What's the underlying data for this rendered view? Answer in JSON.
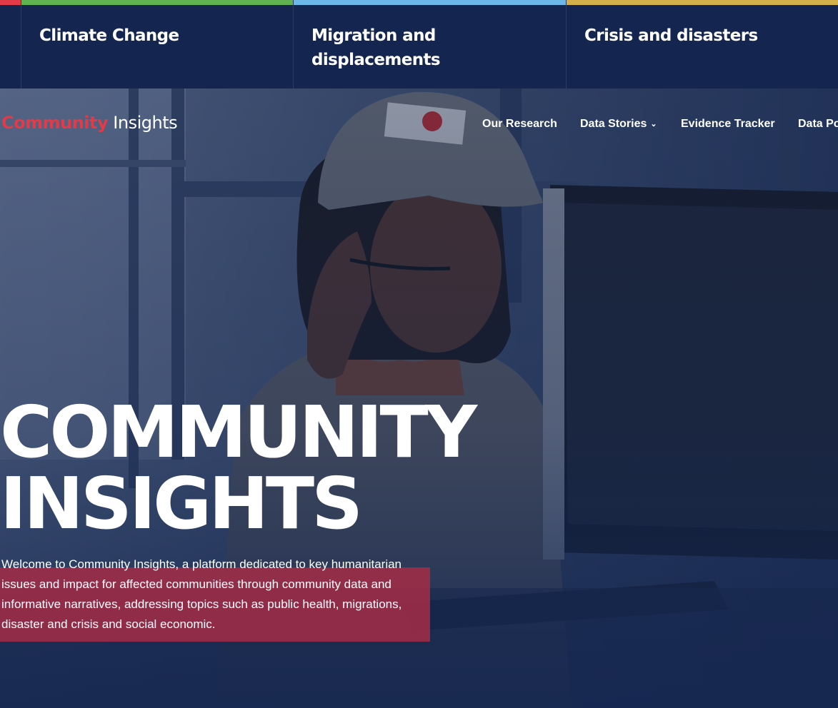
{
  "topics": [
    {
      "label": "",
      "color": "#e23a46"
    },
    {
      "label": "Climate Change",
      "color": "#5fb24f"
    },
    {
      "label": "Migration and displacements",
      "color": "#6cb8e8"
    },
    {
      "label": "Crisis and disasters",
      "color": "#d4b04a"
    }
  ],
  "brand": {
    "part1": "Community",
    "part2": "Insights"
  },
  "nav": {
    "items": [
      "Our Research",
      "Data Stories",
      "Evidence Tracker",
      "Data Po"
    ],
    "dropdown_icon": "chevron-down-icon"
  },
  "hero": {
    "headline_line1": "COMMUNITY",
    "headline_line2": "INSIGHTS",
    "intro": "Welcome to Community Insights, a platform dedicated to key humanitarian issues and impact for affected communities through community data and informative narratives, addressing topics such as public health, migrations, disaster and crisis and social economic.",
    "overlay_color": "#142650",
    "highlight_color": "#a02c45"
  }
}
